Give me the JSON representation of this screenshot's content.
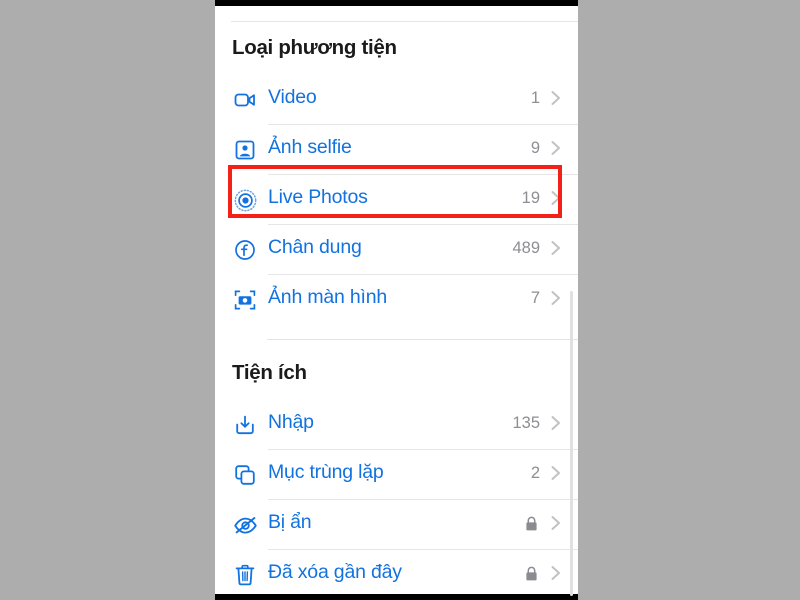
{
  "app": {
    "background_color": "#adadad",
    "panel_color": "#ffffff",
    "accent_color": "#1272e0",
    "secondary_text_color": "#8e8e93",
    "highlight_color": "#f32118"
  },
  "sections": [
    {
      "id": "media-types",
      "title": "Loại phương tiện",
      "rows": [
        {
          "id": "video",
          "icon": "video-camera-icon",
          "label": "Video",
          "count": "1",
          "locked": false,
          "highlighted": false
        },
        {
          "id": "selfies",
          "icon": "portrait-frame-icon",
          "label": "Ảnh selfie",
          "count": "9",
          "locked": false,
          "highlighted": false
        },
        {
          "id": "live-photos",
          "icon": "live-photo-icon",
          "label": "Live Photos",
          "count": "19",
          "locked": false,
          "highlighted": true
        },
        {
          "id": "portrait",
          "icon": "aperture-f-icon",
          "label": "Chân dung",
          "count": "489",
          "locked": false,
          "highlighted": false
        },
        {
          "id": "screenshots",
          "icon": "screenshot-icon",
          "label": "Ảnh màn hình",
          "count": "7",
          "locked": false,
          "highlighted": false
        }
      ]
    },
    {
      "id": "utilities",
      "title": "Tiện ích",
      "rows": [
        {
          "id": "imports",
          "icon": "import-download-icon",
          "label": "Nhập",
          "count": "135",
          "locked": false,
          "highlighted": false
        },
        {
          "id": "duplicates",
          "icon": "duplicate-stack-icon",
          "label": "Mục trùng lặp",
          "count": "2",
          "locked": false,
          "highlighted": false
        },
        {
          "id": "hidden",
          "icon": "eye-slash-icon",
          "label": "Bị ẩn",
          "count": "",
          "locked": true,
          "highlighted": false
        },
        {
          "id": "recently-deleted",
          "icon": "trash-icon",
          "label": "Đã xóa gần đây",
          "count": "",
          "locked": true,
          "highlighted": false
        }
      ]
    }
  ]
}
